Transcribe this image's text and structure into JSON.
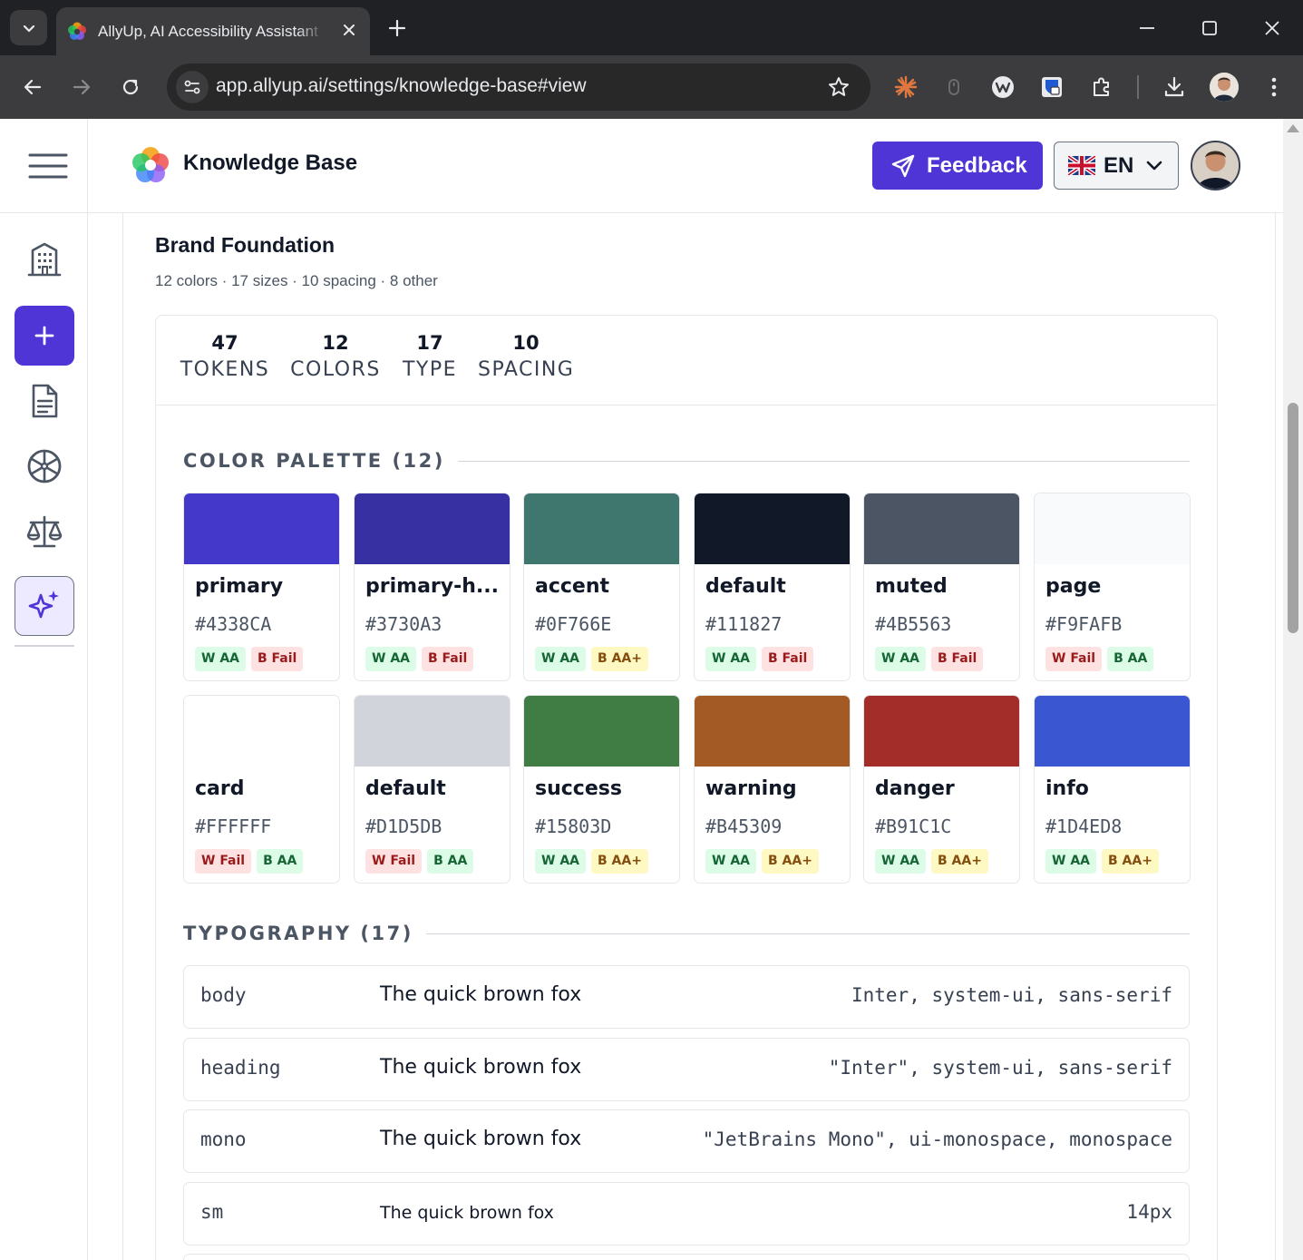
{
  "browser": {
    "tab_title": "AllyUp, AI Accessibility Assistant",
    "url": "app.allyup.ai/settings/knowledge-base#view"
  },
  "header": {
    "title": "Knowledge Base",
    "feedback_label": "Feedback",
    "language": "EN"
  },
  "section": {
    "title": "Brand Foundation",
    "subtitle": "12 colors · 17 sizes · 10 spacing · 8 other"
  },
  "stats": [
    {
      "value": "47",
      "label": "TOKENS"
    },
    {
      "value": "12",
      "label": "COLORS"
    },
    {
      "value": "17",
      "label": "TYPE"
    },
    {
      "value": "10",
      "label": "SPACING"
    }
  ],
  "palette": {
    "title": "COLOR PALETTE (12)",
    "colors": [
      {
        "name": "primary",
        "hex": "#4338CA",
        "color": "#4338CA",
        "badges": [
          {
            "text": "W AA",
            "kind": "pass"
          },
          {
            "text": "B Fail",
            "kind": "fail"
          }
        ]
      },
      {
        "name": "primary-h...",
        "hex": "#3730A3",
        "color": "#3730A3",
        "badges": [
          {
            "text": "W AA",
            "kind": "pass"
          },
          {
            "text": "B Fail",
            "kind": "fail"
          }
        ]
      },
      {
        "name": "accent",
        "hex": "#0F766E",
        "color": "#3F766E",
        "badges": [
          {
            "text": "W AA",
            "kind": "pass"
          },
          {
            "text": "B AA+",
            "kind": "aaa"
          }
        ]
      },
      {
        "name": "default",
        "hex": "#111827",
        "color": "#111827",
        "badges": [
          {
            "text": "W AA",
            "kind": "pass"
          },
          {
            "text": "B Fail",
            "kind": "fail"
          }
        ]
      },
      {
        "name": "muted",
        "hex": "#4B5563",
        "color": "#4B5563",
        "badges": [
          {
            "text": "W AA",
            "kind": "pass"
          },
          {
            "text": "B Fail",
            "kind": "fail"
          }
        ]
      },
      {
        "name": "page",
        "hex": "#F9FAFB",
        "color": "#F9FAFB",
        "badges": [
          {
            "text": "W Fail",
            "kind": "fail"
          },
          {
            "text": "B AA",
            "kind": "pass"
          }
        ]
      },
      {
        "name": "card",
        "hex": "#FFFFFF",
        "color": "#FFFFFF",
        "badges": [
          {
            "text": "W Fail",
            "kind": "fail"
          },
          {
            "text": "B AA",
            "kind": "pass"
          }
        ]
      },
      {
        "name": "default",
        "hex": "#D1D5DB",
        "color": "#D1D5DB",
        "badges": [
          {
            "text": "W Fail",
            "kind": "fail"
          },
          {
            "text": "B AA",
            "kind": "pass"
          }
        ]
      },
      {
        "name": "success",
        "hex": "#15803D",
        "color": "#3F7D45",
        "badges": [
          {
            "text": "W AA",
            "kind": "pass"
          },
          {
            "text": "B AA+",
            "kind": "aaa"
          }
        ]
      },
      {
        "name": "warning",
        "hex": "#B45309",
        "color": "#A35A24",
        "badges": [
          {
            "text": "W AA",
            "kind": "pass"
          },
          {
            "text": "B AA+",
            "kind": "aaa"
          }
        ]
      },
      {
        "name": "danger",
        "hex": "#B91C1C",
        "color": "#A32D29",
        "badges": [
          {
            "text": "W AA",
            "kind": "pass"
          },
          {
            "text": "B AA+",
            "kind": "aaa"
          }
        ]
      },
      {
        "name": "info",
        "hex": "#1D4ED8",
        "color": "#3A56D0",
        "badges": [
          {
            "text": "W AA",
            "kind": "pass"
          },
          {
            "text": "B AA+",
            "kind": "aaa"
          }
        ]
      }
    ]
  },
  "typography": {
    "title": "TYPOGRAPHY (17)",
    "rows": [
      {
        "name": "body",
        "sample": "The quick brown fox",
        "value": "Inter, system-ui, sans-serif"
      },
      {
        "name": "heading",
        "sample": "The quick brown fox",
        "value": "\"Inter\", system-ui, sans-serif"
      },
      {
        "name": "mono",
        "sample": "The quick brown fox",
        "value": "\"JetBrains Mono\", ui-monospace, monospace"
      },
      {
        "name": "sm",
        "sample": "The quick brown fox",
        "value": "14px"
      }
    ]
  }
}
